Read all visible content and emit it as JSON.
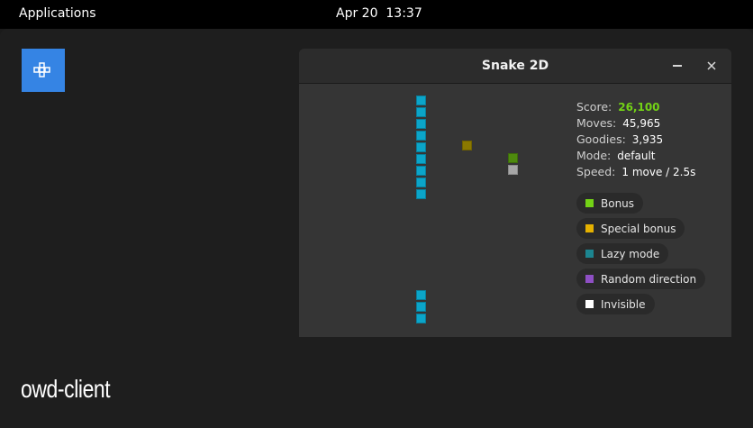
{
  "topbar": {
    "applications_label": "Applications",
    "clock": "Apr 20  13:37"
  },
  "desktop": {
    "label": "owd-client",
    "app_icon": "snake-grid-icon"
  },
  "window": {
    "title": "Snake 2D",
    "minimize_icon": "minimize-icon",
    "close_icon": "close-icon"
  },
  "stats": {
    "score_label": "Score:",
    "score": "26,100",
    "moves_label": "Moves:",
    "moves": "45,965",
    "goodies_label": "Goodies:",
    "goodies": "3,935",
    "mode_label": "Mode:",
    "mode": "default",
    "speed_label": "Speed:",
    "speed": "1 move / 2.5s"
  },
  "legend": [
    {
      "label": "Bonus",
      "color": "#73d216"
    },
    {
      "label": "Special bonus",
      "color": "#e5b100"
    },
    {
      "label": "Lazy mode",
      "color": "#1c8590"
    },
    {
      "label": "Random direction",
      "color": "#8e4fc4"
    },
    {
      "label": "Invisible",
      "color": "#ffffff"
    }
  ],
  "colors": {
    "snake": "#0ba5c9",
    "goodie": "#8a7800",
    "bonus": "#4e8a0e",
    "invisible": "#a7a7a7",
    "accent": "#3584e4",
    "score": "#73d216"
  }
}
